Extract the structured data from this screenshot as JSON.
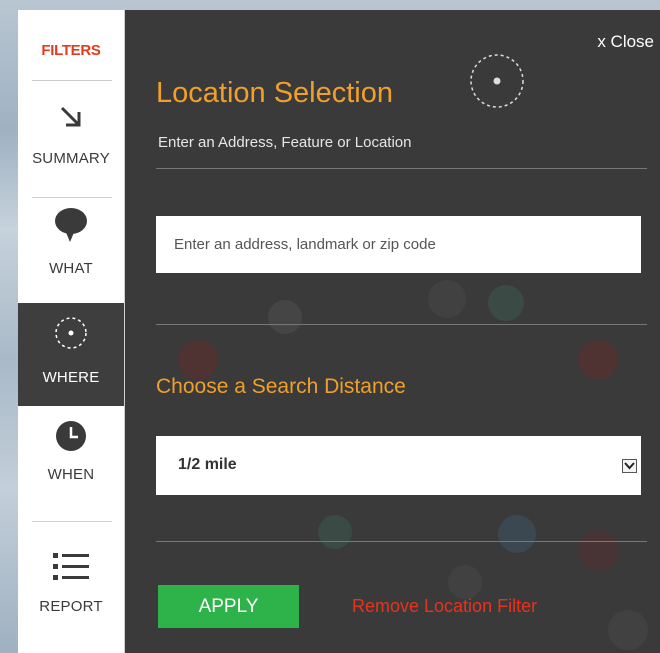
{
  "sidebar": {
    "filters_label": "FILTERS",
    "items": [
      {
        "label": "SUMMARY",
        "icon": "arrow-down-right-icon",
        "active": false
      },
      {
        "label": "WHAT",
        "icon": "speech-bubble-icon",
        "active": false
      },
      {
        "label": "WHERE",
        "icon": "location-target-icon",
        "active": true
      },
      {
        "label": "WHEN",
        "icon": "clock-icon",
        "active": false
      },
      {
        "label": "REPORT",
        "icon": "list-icon",
        "active": false
      }
    ]
  },
  "panel": {
    "close_label": "x Close",
    "title": "Location Selection",
    "subtitle": "Enter an Address, Feature or Location",
    "address_input": {
      "placeholder": "Enter an address, landmark or zip code",
      "value": ""
    },
    "distance_title": "Choose a Search Distance",
    "distance_select": {
      "selected": "1/2 mile"
    },
    "apply_label": "APPLY",
    "remove_label": "Remove Location Filter"
  },
  "colors": {
    "accent_orange": "#f0a02a",
    "filters_red": "#e33b1c",
    "apply_green": "#2eb34a",
    "remove_red": "#e8331c",
    "panel_bg": "#3a3a3a"
  }
}
